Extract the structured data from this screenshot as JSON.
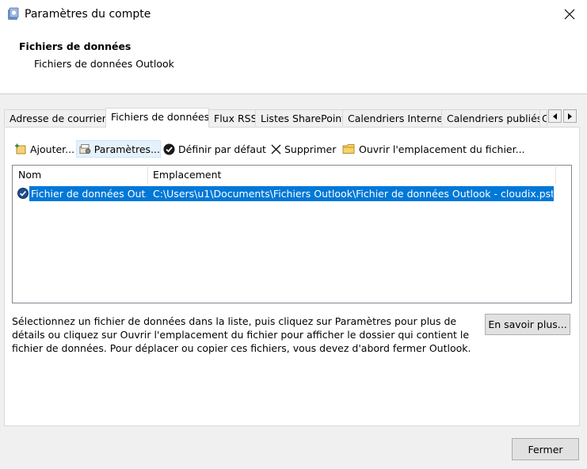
{
  "window": {
    "title": "Paramètres du compte",
    "header_title": "Fichiers de données",
    "header_subtitle": "Fichiers de données Outlook"
  },
  "tabs": [
    {
      "label": "Adresse de courrier",
      "active": false
    },
    {
      "label": "Fichiers de données",
      "active": true
    },
    {
      "label": "Flux RSS",
      "active": false
    },
    {
      "label": "Listes SharePoint",
      "active": false
    },
    {
      "label": "Calendriers Internet",
      "active": false
    },
    {
      "label": "Calendriers publiés",
      "active": false
    },
    {
      "label": "Carnets d'adresses",
      "active": false
    }
  ],
  "toolbar": {
    "add": "Ajouter...",
    "settings": "Paramètres...",
    "set_default": "Définir par défaut",
    "remove": "Supprimer",
    "open_location": "Ouvrir l'emplacement du fichier..."
  },
  "list": {
    "columns": [
      "Nom",
      "Emplacement"
    ],
    "rows": [
      {
        "name": "Fichier de données Out...",
        "location": "C:\\Users\\u1\\Documents\\Fichiers Outlook\\Fichier de données Outlook - cloudix.pst",
        "default": true,
        "selected": true
      }
    ]
  },
  "info_text": "Sélectionnez un fichier de données dans la liste, puis cliquez sur Paramètres pour plus de détails ou cliquez sur Ouvrir l'emplacement du fichier pour afficher le dossier qui contient le fichier de données. Pour déplacer ou copier ces fichiers, vous devez d'abord fermer Outlook.",
  "buttons": {
    "learn_more": "En savoir plus...",
    "close": "Fermer"
  },
  "colors": {
    "selection": "#0078d7",
    "window_bg": "#f0f0f0"
  }
}
